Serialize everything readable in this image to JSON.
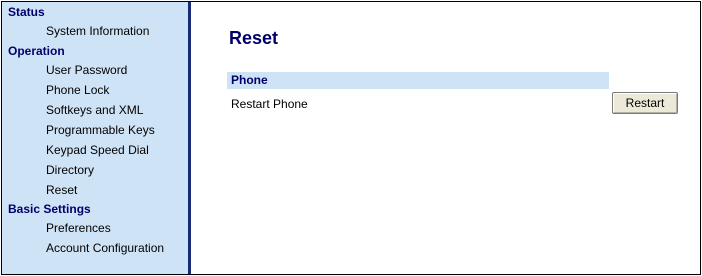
{
  "sidebar": {
    "sections": [
      {
        "title": "Status",
        "items": [
          "System Information"
        ]
      },
      {
        "title": "Operation",
        "items": [
          "User Password",
          "Phone Lock",
          "Softkeys and XML",
          "Programmable Keys",
          "Keypad Speed Dial",
          "Directory",
          "Reset"
        ]
      },
      {
        "title": "Basic Settings",
        "items": [
          "Preferences",
          "Account Configuration"
        ]
      }
    ]
  },
  "main": {
    "title": "Reset",
    "section_header": "Phone",
    "row_label": "Restart Phone",
    "restart_button": "Restart"
  },
  "colors": {
    "sidebar_bg": "#cfe3f6",
    "heading": "#00006a",
    "sidebar_border": "#1a2a78"
  }
}
